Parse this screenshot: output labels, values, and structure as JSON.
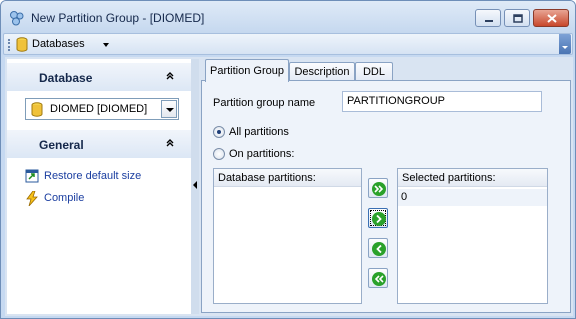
{
  "window": {
    "title": "New Partition Group - [DIOMED]"
  },
  "toolbar": {
    "databases_label": "Databases"
  },
  "left_panel": {
    "database_section_title": "Database",
    "database_combo_value": "DIOMED [DIOMED]",
    "general_section_title": "General",
    "links": [
      {
        "label": "Restore default size",
        "icon": "restore-size-icon"
      },
      {
        "label": "Compile",
        "icon": "lightning-icon"
      }
    ]
  },
  "tabs": [
    {
      "label": "Partition Group",
      "active": true
    },
    {
      "label": "Description",
      "active": false
    },
    {
      "label": "DDL",
      "active": false
    }
  ],
  "form": {
    "group_name_label": "Partition group name",
    "group_name_value": "PARTITIONGROUP",
    "radio_all_label": "All partitions",
    "radio_on_label": "On partitions:",
    "selected_radio": "all"
  },
  "lists": {
    "database_partitions_header": "Database partitions:",
    "database_partitions": [],
    "selected_partitions_header": "Selected partitions:",
    "selected_partitions": [
      "0"
    ]
  },
  "colors": {
    "accent": "#1e8c1e",
    "link": "#1b3ea0",
    "frame": "#c6d9f1"
  }
}
